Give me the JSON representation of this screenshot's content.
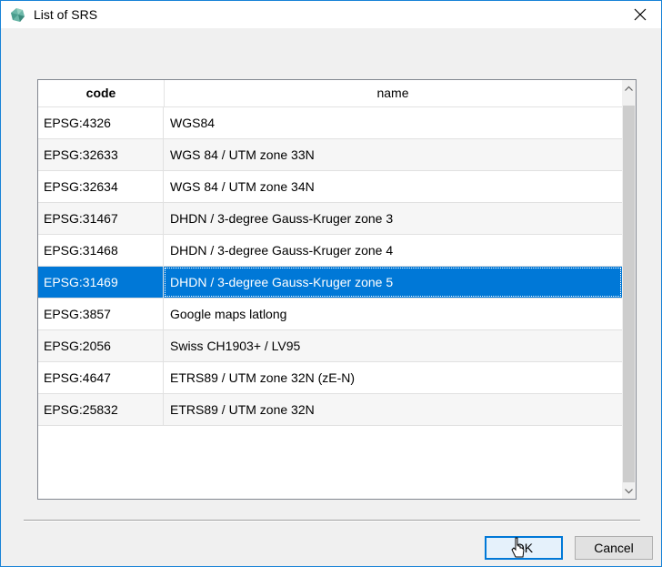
{
  "window": {
    "title": "List of SRS",
    "app_icon": "qgis-logo-icon",
    "close_icon": "close-icon"
  },
  "table": {
    "headers": {
      "code": "code",
      "name": "name"
    },
    "rows": [
      {
        "code": "EPSG:4326",
        "name": "WGS84",
        "selected": false
      },
      {
        "code": "EPSG:32633",
        "name": "WGS 84 / UTM zone 33N",
        "selected": false
      },
      {
        "code": "EPSG:32634",
        "name": "WGS 84 / UTM zone 34N",
        "selected": false
      },
      {
        "code": "EPSG:31467",
        "name": "DHDN / 3-degree Gauss-Kruger zone 3",
        "selected": false
      },
      {
        "code": "EPSG:31468",
        "name": "DHDN / 3-degree Gauss-Kruger zone 4",
        "selected": false
      },
      {
        "code": "EPSG:31469",
        "name": "DHDN / 3-degree Gauss-Kruger zone 5",
        "selected": true
      },
      {
        "code": "EPSG:3857",
        "name": "Google maps latlong",
        "selected": false
      },
      {
        "code": "EPSG:2056",
        "name": "Swiss CH1903+ / LV95",
        "selected": false
      },
      {
        "code": "EPSG:4647",
        "name": "ETRS89 / UTM zone 32N (zE-N)",
        "selected": false
      },
      {
        "code": "EPSG:25832",
        "name": "ETRS89 / UTM zone 32N",
        "selected": false
      }
    ]
  },
  "buttons": {
    "ok": "OK",
    "cancel": "Cancel"
  },
  "colors": {
    "selection": "#0078d7",
    "window_border": "#1883d7",
    "default_button_border": "#0078d7"
  }
}
